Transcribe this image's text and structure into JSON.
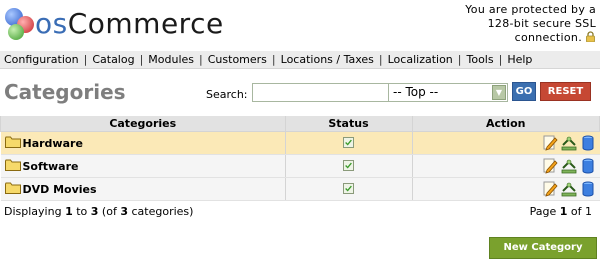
{
  "header": {
    "logo_prefix": "os",
    "logo_suffix": "Commerce",
    "ssl_line1": "You are protected by a",
    "ssl_line2": "128-bit secure SSL",
    "ssl_line3": "connection."
  },
  "menu": [
    "Configuration",
    "Catalog",
    "Modules",
    "Customers",
    "Locations / Taxes",
    "Localization",
    "Tools",
    "Help"
  ],
  "page": {
    "title": "Categories",
    "search_label": "Search:",
    "search_value": "",
    "parent_selected": "-- Top --",
    "go_label": "GO",
    "reset_label": "RESET"
  },
  "table": {
    "headers": [
      "Categories",
      "Status",
      "Action"
    ],
    "rows": [
      {
        "name": "Hardware",
        "status": "enabled"
      },
      {
        "name": "Software",
        "status": "enabled"
      },
      {
        "name": "DVD Movies",
        "status": "enabled"
      }
    ]
  },
  "footer": {
    "displaying_text": "Displaying",
    "from": "1",
    "to_word": "to",
    "to": "3",
    "of_open": "(of",
    "total": "3",
    "of_close": "categories)",
    "page_label": "Page",
    "page_current": "1",
    "page_of": "of",
    "page_total": "1",
    "new_button": "New Category"
  },
  "colors": {
    "highlight_row": "#fbe9b7",
    "go_button": "#3b6fb0",
    "reset_button": "#c64834",
    "new_button": "#7aa12d"
  }
}
